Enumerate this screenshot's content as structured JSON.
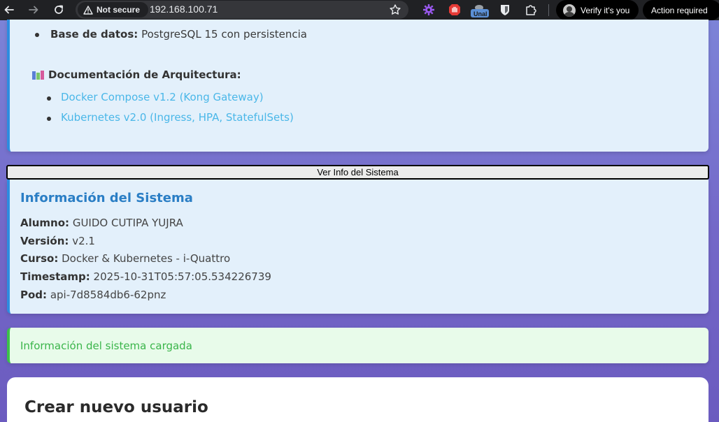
{
  "browser": {
    "security_label": "Not secure",
    "url": "192.168.100.71",
    "ext_badge": "Unal",
    "profile_label": "Verify it's you",
    "action_label": "Action required"
  },
  "info_card": {
    "db_label": "Base de datos:",
    "db_value": "PostgreSQL 15 con persistencia",
    "docs_heading": "Documentación de Arquitectura:",
    "links": [
      "Docker Compose v1.2 (Kong Gateway)",
      "Kubernetes v2.0 (Ingress, HPA, StatefulSets)"
    ]
  },
  "sys_button_label": "Ver Info del Sistema",
  "system": {
    "title": "Información del Sistema",
    "rows": [
      {
        "label": "Alumno:",
        "value": "GUIDO CUTIPA YUJRA"
      },
      {
        "label": "Versión:",
        "value": "v2.1"
      },
      {
        "label": "Curso:",
        "value": "Docker & Kubernetes - i-Quattro"
      },
      {
        "label": "Timestamp:",
        "value": "2025-10-31T05:57:05.534226739"
      },
      {
        "label": "Pod:",
        "value": "api-7d8584db6-62pnz"
      }
    ]
  },
  "status_message": "Información del sistema cargada",
  "form": {
    "title": "Crear nuevo usuario"
  },
  "colors": {
    "accent_blue": "#2e8de0",
    "link_blue": "#4ab7e8",
    "success_green": "#3cc24a"
  }
}
